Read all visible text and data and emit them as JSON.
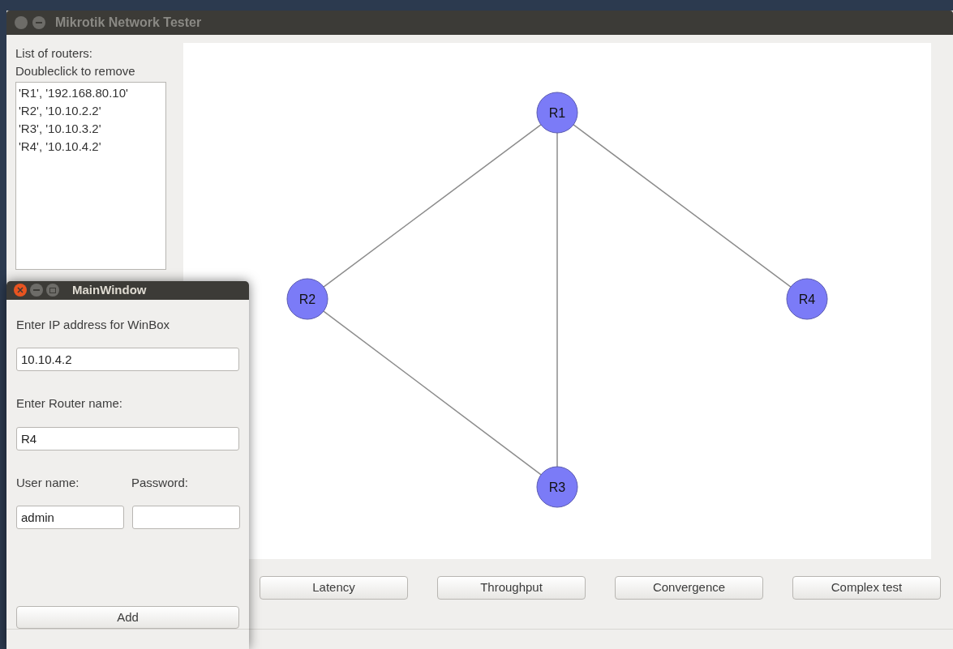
{
  "window": {
    "title": "Mikrotik Network Tester"
  },
  "router_list": {
    "label_lines": [
      "List of routers:",
      "Doubleclick to remove"
    ],
    "items": [
      "'R1', '192.168.80.10'",
      "'R2', '10.10.2.2'",
      "'R3', '10.10.3.2'",
      "'R4', '10.10.4.2'"
    ]
  },
  "graph": {
    "nodes": [
      {
        "label": "R1"
      },
      {
        "label": "R2"
      },
      {
        "label": "R4"
      },
      {
        "label": "R3"
      }
    ]
  },
  "buttons": [
    "Latency",
    "Throughput",
    "Convergence",
    "Complex test"
  ],
  "dialog": {
    "title": "MainWindow",
    "ip_label": "Enter IP address for WinBox",
    "ip_value": "10.10.4.2",
    "name_label": "Enter Router name:",
    "name_value": "R4",
    "user_label": "User name:",
    "password_label": "Password:",
    "user_value": "admin",
    "add_button": "Add"
  }
}
